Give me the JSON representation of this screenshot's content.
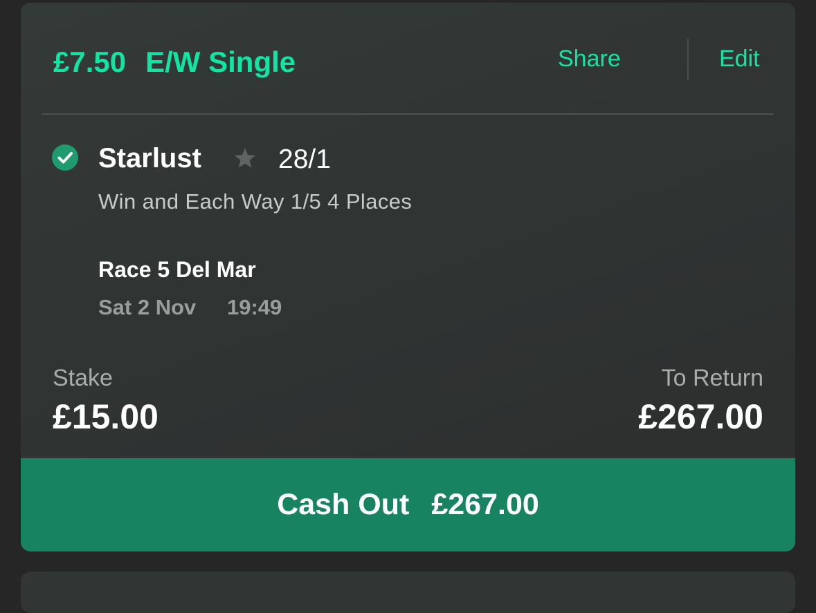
{
  "bet": {
    "amount": "£7.50",
    "type": "E/W Single",
    "share_label": "Share",
    "edit_label": "Edit"
  },
  "selection": {
    "name": "Starlust",
    "odds": "28/1",
    "market": "Win and Each Way 1/5 4 Places",
    "status_icon": "check-circle-icon",
    "favourite_icon": "star-icon"
  },
  "event": {
    "name": "Race 5 Del Mar",
    "date": "Sat 2 Nov",
    "time": "19:49"
  },
  "totals": {
    "stake_label": "Stake",
    "stake_value": "£15.00",
    "return_label": "To Return",
    "return_value": "£267.00"
  },
  "cashout": {
    "label": "Cash Out",
    "amount": "£267.00"
  },
  "colors": {
    "accent": "#12e4a3",
    "cashout_bg": "#178360",
    "card_bg": "#313534",
    "page_bg": "#262626"
  }
}
